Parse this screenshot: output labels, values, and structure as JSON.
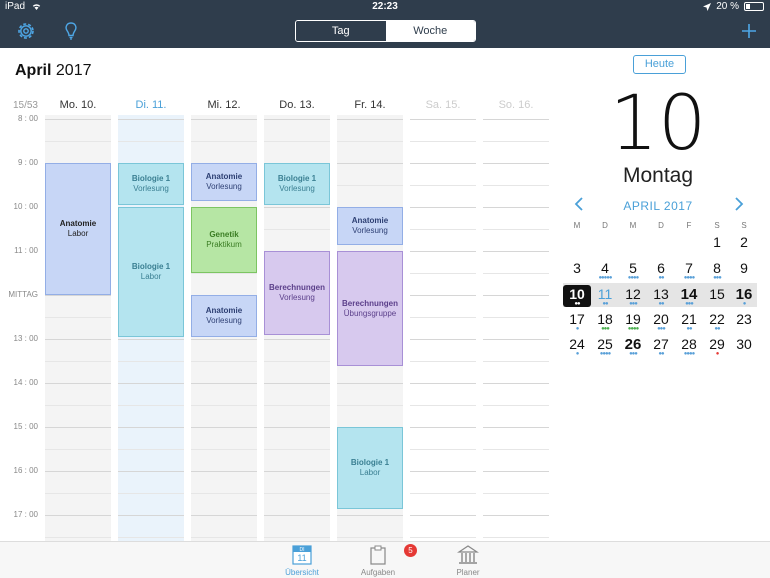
{
  "status": {
    "device": "iPad",
    "time": "22:23",
    "battery": "20 %"
  },
  "nav": {
    "tab_day": "Tag",
    "tab_week": "Woche"
  },
  "title": {
    "month": "April",
    "year": " 2017"
  },
  "week_number": "15/53",
  "days": [
    {
      "label": "Mo. 10.",
      "state": "normal"
    },
    {
      "label": "Di. 11.",
      "state": "today"
    },
    {
      "label": "Mi. 12.",
      "state": "normal"
    },
    {
      "label": "Do. 13.",
      "state": "normal"
    },
    {
      "label": "Fr. 14.",
      "state": "normal"
    },
    {
      "label": "Sa. 15.",
      "state": "weekend"
    },
    {
      "label": "So. 16.",
      "state": "weekend"
    }
  ],
  "time_labels": [
    "8 : 00",
    "9 : 00",
    "10 : 00",
    "11 : 00",
    "MITTAG",
    "13 : 00",
    "14 : 00",
    "15 : 00",
    "16 : 00",
    "17 : 00"
  ],
  "events": [
    {
      "day": 0,
      "start": 9.0,
      "end": 12.0,
      "title": "Anatomie",
      "subtitle": "Labor",
      "bg": "#c7d6f6",
      "border": "#93aee6",
      "color": "#222"
    },
    {
      "day": 1,
      "start": 9.0,
      "end": 9.95,
      "title": "Biologie 1",
      "subtitle": "Vorlesung",
      "bg": "#b4e4ef",
      "border": "#7ac6d8",
      "color": "#3a7f92"
    },
    {
      "day": 1,
      "start": 10.0,
      "end": 12.95,
      "title": "Biologie 1",
      "subtitle": "Labor",
      "bg": "#b4e4ef",
      "border": "#7ac6d8",
      "color": "#3a7f92"
    },
    {
      "day": 2,
      "start": 9.0,
      "end": 9.85,
      "title": "Anatomie",
      "subtitle": "Vorlesung",
      "bg": "#c7d6f6",
      "border": "#93aee6",
      "color": "#2d3f73"
    },
    {
      "day": 2,
      "start": 10.0,
      "end": 11.5,
      "title": "Genetik",
      "subtitle": "Praktikum",
      "bg": "#b6e6a4",
      "border": "#7cc562",
      "color": "#3b7d24"
    },
    {
      "day": 2,
      "start": 12.0,
      "end": 12.95,
      "title": "Anatomie",
      "subtitle": "Vorlesung",
      "bg": "#c7d6f6",
      "border": "#93aee6",
      "color": "#2d3f73"
    },
    {
      "day": 3,
      "start": 9.0,
      "end": 9.95,
      "title": "Biologie 1",
      "subtitle": "Vorlesung",
      "bg": "#b4e4ef",
      "border": "#7ac6d8",
      "color": "#3a7f92"
    },
    {
      "day": 3,
      "start": 11.0,
      "end": 12.9,
      "title": "Berechnungen",
      "subtitle": "Vorlesung",
      "bg": "#d7c9ee",
      "border": "#a890d6",
      "color": "#5b3f8a"
    },
    {
      "day": 4,
      "start": 10.0,
      "end": 10.85,
      "title": "Anatomie",
      "subtitle": "Vorlesung",
      "bg": "#c7d6f6",
      "border": "#93aee6",
      "color": "#2d3f73"
    },
    {
      "day": 4,
      "start": 11.0,
      "end": 13.6,
      "title": "Berechnungen",
      "subtitle": "Übungsgruppe",
      "bg": "#d7c9ee",
      "border": "#a890d6",
      "color": "#5b3f8a"
    },
    {
      "day": 4,
      "start": 15.0,
      "end": 16.85,
      "title": "Biologie 1",
      "subtitle": "Labor",
      "bg": "#b4e4ef",
      "border": "#7ac6d8",
      "color": "#3a7f92"
    }
  ],
  "side": {
    "today_button": "Heute",
    "big_date": "10",
    "big_weekday": "Montag",
    "cal_month": "APRIL 2017",
    "weekdays": [
      "M",
      "D",
      "M",
      "D",
      "F",
      "S",
      "S"
    ],
    "rows": [
      [
        null,
        null,
        null,
        null,
        null,
        {
          "d": "1"
        },
        {
          "d": "2"
        }
      ],
      [
        {
          "d": "3"
        },
        {
          "d": "4",
          "dots": "●●●●●",
          "dc": "#5aa0d8"
        },
        {
          "d": "5",
          "dots": "●●●●",
          "dc": "#5aa0d8"
        },
        {
          "d": "6",
          "dots": "●●",
          "dc": "#5aa0d8"
        },
        {
          "d": "7",
          "dots": "●●●●",
          "dc": "#5aa0d8"
        },
        {
          "d": "8",
          "dots": "●●●",
          "dc": "#5aa0d8"
        },
        {
          "d": "9"
        }
      ],
      [
        {
          "d": "10",
          "today": true,
          "dots": "●●",
          "dc": "#fff"
        },
        {
          "d": "11",
          "blue": true,
          "dots": "●●",
          "dc": "#5aa0d8"
        },
        {
          "d": "12",
          "dots": "●●●",
          "dc": "#5aa0d8"
        },
        {
          "d": "13",
          "dots": "●●",
          "dc": "#5aa0d8"
        },
        {
          "d": "14",
          "bold": true,
          "dots": "●●●",
          "dc": "#5aa0d8"
        },
        {
          "d": "15"
        },
        {
          "d": "16",
          "bold": true,
          "dots": "●",
          "dc": "#5aa0d8"
        }
      ],
      [
        {
          "d": "17",
          "dots": "●",
          "dc": "#5aa0d8"
        },
        {
          "d": "18",
          "dots": "●●●",
          "dc": "#4caf50"
        },
        {
          "d": "19",
          "dots": "●●●●",
          "dc": "#4caf50"
        },
        {
          "d": "20",
          "dots": "●●●",
          "dc": "#5aa0d8"
        },
        {
          "d": "21",
          "dots": "●●",
          "dc": "#5aa0d8"
        },
        {
          "d": "22",
          "dots": "●●",
          "dc": "#5aa0d8"
        },
        {
          "d": "23"
        }
      ],
      [
        {
          "d": "24",
          "dots": "●",
          "dc": "#5aa0d8"
        },
        {
          "d": "25",
          "dots": "●●●●",
          "dc": "#5aa0d8"
        },
        {
          "d": "26",
          "bold": true,
          "dots": "●●●",
          "dc": "#5aa0d8"
        },
        {
          "d": "27",
          "dots": "●●",
          "dc": "#5aa0d8"
        },
        {
          "d": "28",
          "dots": "●●●●",
          "dc": "#5aa0d8"
        },
        {
          "d": "29",
          "dots": "●",
          "dc": "#e53935"
        },
        {
          "d": "30"
        }
      ]
    ]
  },
  "tabs": {
    "overview": "Übersicht",
    "overview_icon_top": "DI",
    "overview_icon_num": "11",
    "tasks": "Aufgaben",
    "tasks_badge": "5",
    "planner": "Planer"
  },
  "colors": {
    "accent": "#4aa0d8",
    "navbar": "#2f3d4c",
    "today_column": "#eaf3fb",
    "normal_column": "#f4f4f4"
  }
}
